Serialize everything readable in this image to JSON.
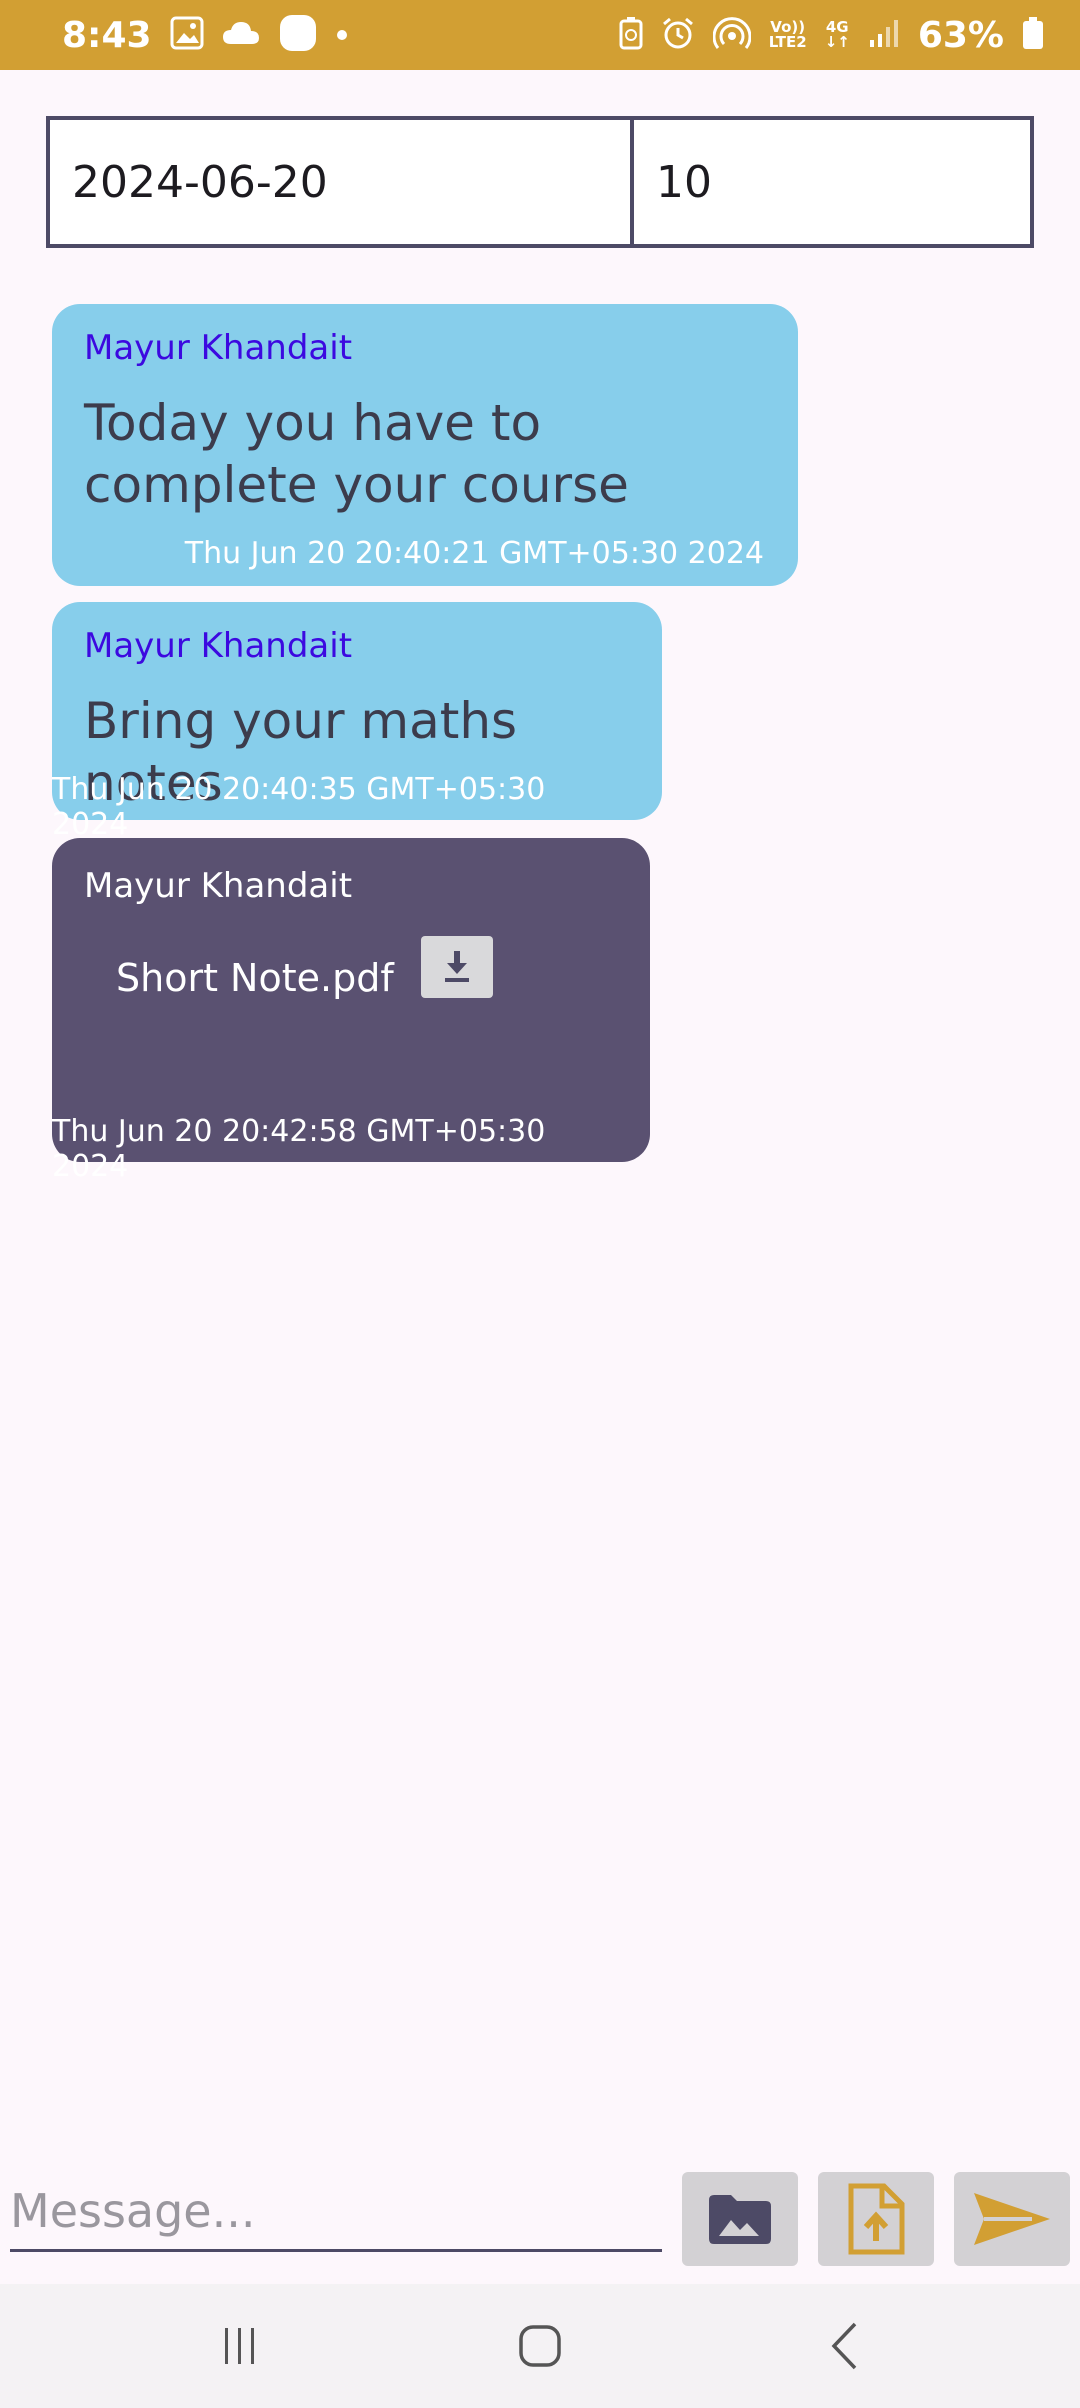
{
  "status_bar": {
    "time": "8:43",
    "network_label_top": "Vo))",
    "network_label_bottom": "LTE2",
    "network_type": "4G",
    "battery": "63%"
  },
  "header": {
    "date": "2024-06-20",
    "count": "10"
  },
  "messages": [
    {
      "sender": "Mayur Khandait",
      "text": "Today you have to complete your course",
      "time": "Thu Jun 20 20:40:21 GMT+05:30 2024"
    },
    {
      "sender": "Mayur Khandait",
      "text": "Bring your maths notes",
      "time": "Thu Jun 20 20:40:35 GMT+05:30 2024"
    },
    {
      "sender": "Mayur Khandait",
      "file_name": "Short Note.pdf",
      "time": "Thu Jun 20 20:42:58 GMT+05:30 2024"
    }
  ],
  "composer": {
    "placeholder": "Message..."
  },
  "colors": {
    "status_bar": "#d29f33",
    "bubble_text": "#87ceeb",
    "bubble_file": "#5a5171",
    "sender_name": "#3c09e0",
    "accent": "#d29f33"
  }
}
